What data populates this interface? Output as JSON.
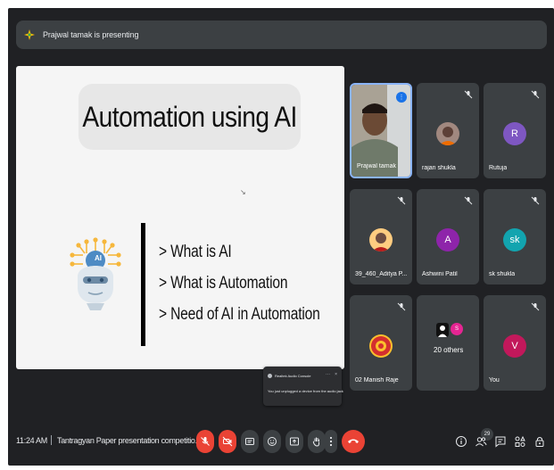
{
  "banner": {
    "text": "Prajwal tamak is presenting",
    "icon": "presenting-icon"
  },
  "slide": {
    "title": "Automation using AI",
    "bullets": [
      "> What is AI",
      "> What is Automation",
      "> Need of AI in Automation"
    ],
    "graphic": "ai-robot-head-icon",
    "robot_label": "AI"
  },
  "toast": {
    "title": "Realtek Audio Console",
    "message": "You just unplugged a device from the audio jack",
    "more": "···",
    "close": "×"
  },
  "participants": [
    {
      "name": "Prajwal tamak",
      "kind": "video",
      "active": true
    },
    {
      "name": "rajan shukla",
      "kind": "photo",
      "muted": true
    },
    {
      "name": "Rutuja",
      "initial": "R",
      "color": "#7e57c2",
      "muted": true
    },
    {
      "name": "39_460_Aditya P...",
      "kind": "photo",
      "muted": true
    },
    {
      "name": "Ashwini Patil",
      "initial": "A",
      "color": "#8e24aa",
      "muted": true
    },
    {
      "name": "sk shukla",
      "initial": "sk",
      "color": "#12a4af",
      "muted": true
    },
    {
      "name": "02 Manish Raje",
      "kind": "logo",
      "muted": true
    },
    {
      "name": "20 others",
      "initial": "S",
      "color": "#e52592"
    },
    {
      "name": "You",
      "initial": "V",
      "color": "#c2185b",
      "muted": true
    }
  ],
  "bottom": {
    "time": "11:24 AM",
    "meeting_name": "Tantragyan Paper presentation competitio...",
    "people_count": "29"
  },
  "colors": {
    "bg": "#202124",
    "tile": "#3c4043",
    "danger": "#ea4335",
    "accent": "#8ab4f8"
  }
}
